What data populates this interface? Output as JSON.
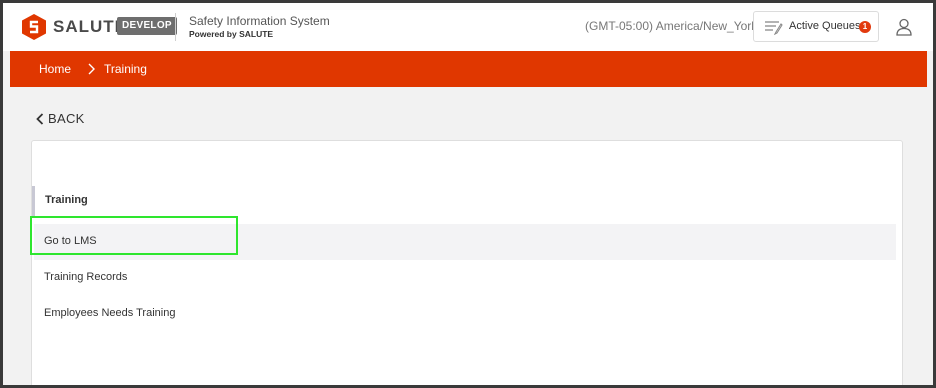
{
  "header": {
    "brand": "SALUTE",
    "env_badge": "DEVELOP",
    "app_title": "Safety Information System",
    "app_powered": "Powered by SALUTE",
    "timezone": "(GMT-05:00) America/New_York",
    "queues_label": "Active Queues",
    "queues_count": "1",
    "icons": [
      "salute-logo",
      "queues-icon",
      "user-icon"
    ]
  },
  "breadcrumb": {
    "items": [
      "Home",
      "Training"
    ],
    "bar_color": "#e03700"
  },
  "back": {
    "label": "BACK"
  },
  "card": {
    "section_title": "Training",
    "items": [
      {
        "label": "Go to LMS",
        "active": true
      },
      {
        "label": "Training Records",
        "active": false
      },
      {
        "label": "Employees Needs Training",
        "active": false
      }
    ]
  },
  "colors": {
    "accent": "#e03700",
    "badge": "#e23a0e",
    "highlight": "#2ee62e"
  }
}
